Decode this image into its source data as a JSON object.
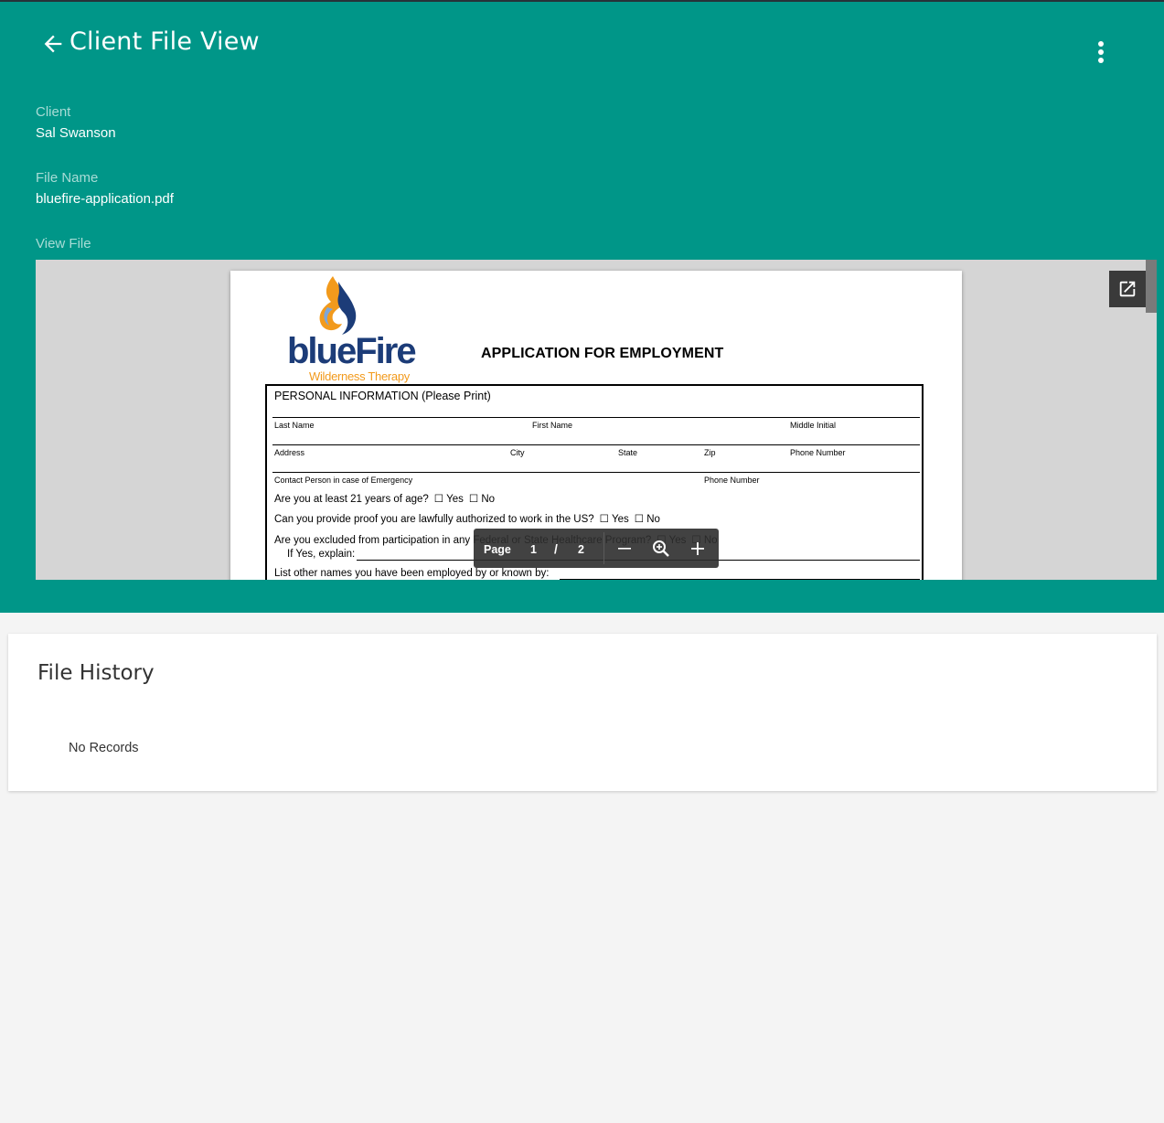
{
  "app_bar": {
    "title": "Client File View",
    "back_icon": "arrow-left-icon",
    "menu_icon": "more-vert-icon"
  },
  "details": {
    "client_label": "Client",
    "client_value": "Sal Swanson",
    "file_name_label": "File Name",
    "file_name_value": "bluefire-application.pdf",
    "view_file_label": "View File"
  },
  "viewer": {
    "open_external_icon": "open-in-new-icon",
    "document": {
      "logo_text": "blueFire",
      "logo_subtext": "Wilderness Therapy",
      "title": "APPLICATION FOR EMPLOYMENT",
      "section_heading": "PERSONAL INFORMATION (Please Print)",
      "row1": [
        "Last Name",
        "First Name",
        "Middle Initial"
      ],
      "row2": [
        "Address",
        "City",
        "State",
        "Zip",
        "Phone Number"
      ],
      "row3": [
        "Contact Person in case of Emergency",
        "Phone Number"
      ],
      "q1": "Are you at least 21 years of age?",
      "q2": "Can you provide proof you are lawfully authorized to work in the US?",
      "q3": "Are you excluded from participation in any Federal or State Healthcare Program?",
      "q3_explain": "If Yes, explain:",
      "q4": "List other names you have been employed by or known by:",
      "opt_yes": "☐ Yes",
      "opt_no": "☐ No"
    },
    "toolbar": {
      "page_label": "Page",
      "current_page": "1",
      "separator": "/",
      "total_pages": "2",
      "zoom_out_icon": "minus-icon",
      "zoom_icon": "zoom-in-magnifier-icon",
      "zoom_in_icon": "plus-icon"
    }
  },
  "history": {
    "title": "File History",
    "empty_text": "No Records"
  },
  "colors": {
    "primary": "#009688",
    "background": "#f4f4f4",
    "label": "#a8dcd6"
  }
}
